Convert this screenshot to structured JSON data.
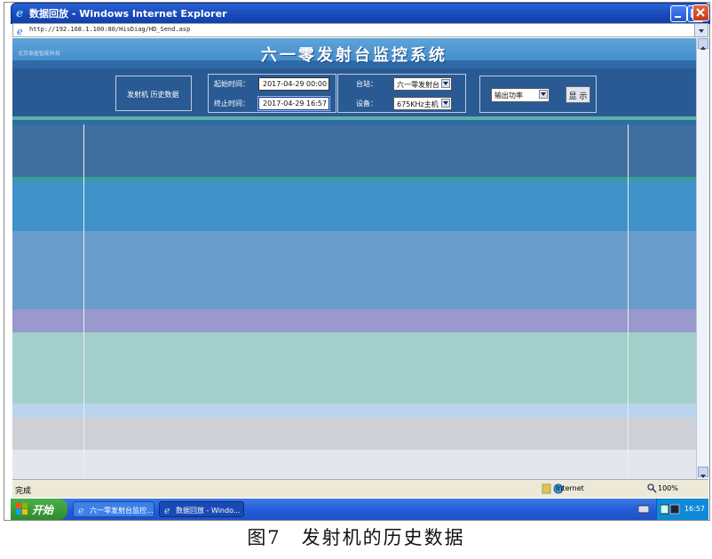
{
  "window": {
    "title": "数据回放 - Windows Internet Explorer"
  },
  "address": {
    "url": "http://192.168.1.100:80/HisDiag/HD_Send.asp"
  },
  "banner": {
    "logo_text": "北京泰盈智能科技",
    "system_title": "六一零发射台监控系统"
  },
  "controls": {
    "section_label": "发射机 历史数据",
    "start_label": "起始时间：",
    "start_value": "2017-04-29 00:00",
    "end_label": "终止时间：",
    "end_value": "2017-04-29 16:57",
    "station_label": "台站：",
    "station_value": "六一零发射台",
    "device_label": "设备：",
    "device_value": "675KHz主机",
    "param_value": "输出功率",
    "show_button": "显 示"
  },
  "status": {
    "text": "完成",
    "zone": "Internet",
    "zoom": "100%"
  },
  "taskbar": {
    "start": "开始",
    "task1": "六一零发射台监控...",
    "task2": "数据回放 - Windo...",
    "clock": "16:57"
  },
  "caption": "图7　发射机的历史数据",
  "colors": {
    "banner": "#3c87c8",
    "ctrlbar": "#2a5a94",
    "taskbar": "#245edb"
  }
}
